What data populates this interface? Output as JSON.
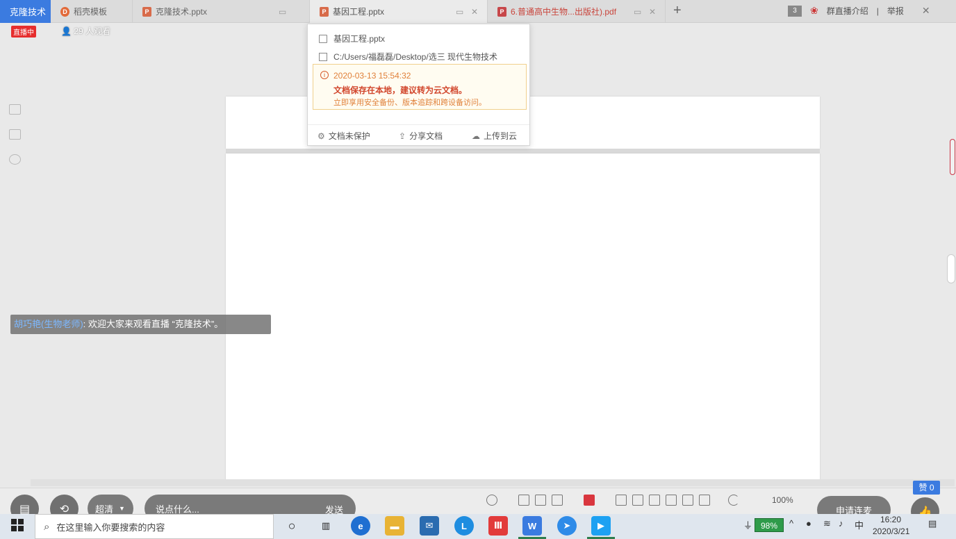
{
  "app_title": "克隆技术",
  "tabs": [
    {
      "label": "稻壳模板",
      "type": "doc"
    },
    {
      "label": "克隆技术.pptx",
      "type": "ppt"
    },
    {
      "label": "基因工程.pptx",
      "type": "ppt",
      "active": true
    },
    {
      "label": "6.普通高中生物...出版社).pdf",
      "type": "pdf"
    }
  ],
  "header_right": {
    "group_intro": "群直播介绍",
    "separator": "|",
    "report": "举报",
    "page_badge": "3"
  },
  "live": {
    "badge": "直播中",
    "viewers": "29 人观看"
  },
  "popover": {
    "file_name": "基因工程.pptx",
    "file_path": "C:/Users/福磊磊/Desktop/选三 现代生物技术",
    "warning_time": "2020-03-13 15:54:32",
    "warning_main": "文档保存在本地，建议转为云文档。",
    "warning_sub": "立即享用安全备份、版本追踪和跨设备访问。",
    "action_protect": "文档未保护",
    "action_share": "分享文档",
    "action_upload": "上传到云"
  },
  "chat": {
    "name": "胡巧艳(生物老师)",
    "message": ": 欢迎大家来观看直播 “克隆技术”。"
  },
  "status_bar": {
    "zoom": "100%"
  },
  "overlay": {
    "quality": "超清",
    "say_placeholder": "说点什么...",
    "send": "发送",
    "connect": "申请连麦",
    "likes": "赞 0"
  },
  "taskbar": {
    "search_placeholder": "在这里输入你要搜索的内容",
    "battery": "98%",
    "ime": "中",
    "time": "16:20",
    "date": "2020/3/21"
  }
}
